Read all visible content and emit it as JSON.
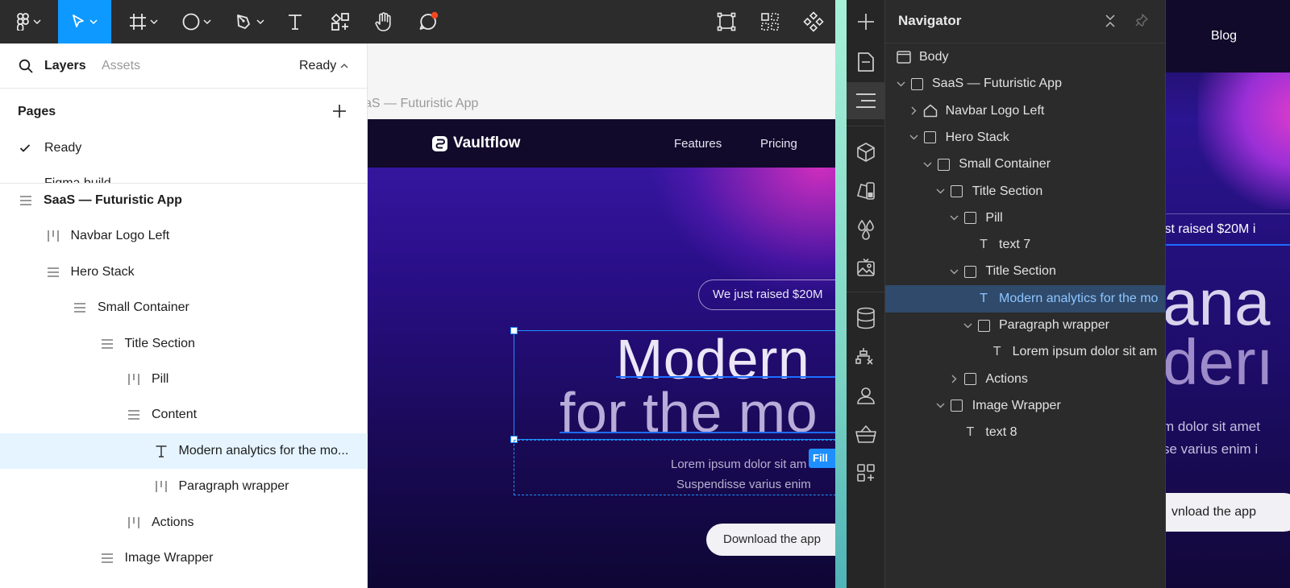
{
  "figma": {
    "left_panel": {
      "tabs": {
        "layers": "Layers",
        "assets": "Assets",
        "page_selector": "Ready"
      },
      "pages": {
        "title": "Pages",
        "items": [
          {
            "label": "Ready",
            "checked": true
          },
          {
            "label": "Figma build",
            "checked": false
          }
        ]
      },
      "layers": [
        {
          "label": "SaaS — Futuristic App",
          "icon": "stack-icon",
          "depth": 0,
          "bold": true
        },
        {
          "label": "Navbar Logo Left",
          "icon": "columns-icon",
          "depth": 1
        },
        {
          "label": "Hero Stack",
          "icon": "stack-icon",
          "depth": 1
        },
        {
          "label": "Small Container",
          "icon": "stack-icon",
          "depth": 2
        },
        {
          "label": "Title Section",
          "icon": "stack-icon",
          "depth": 3
        },
        {
          "label": "Pill",
          "icon": "columns-icon",
          "depth": 4
        },
        {
          "label": "Content",
          "icon": "stack-icon",
          "depth": 4
        },
        {
          "label": "Modern analytics for the mo...",
          "icon": "text-icon",
          "depth": 5,
          "selected": true
        },
        {
          "label": "Paragraph wrapper",
          "icon": "columns-icon",
          "depth": 5
        },
        {
          "label": "Actions",
          "icon": "columns-icon",
          "depth": 4
        },
        {
          "label": "Image Wrapper",
          "icon": "stack-icon",
          "depth": 3
        }
      ]
    },
    "canvas": {
      "frame_label": "aS — Futuristic  App",
      "site": {
        "logo": "Vaultflow",
        "nav_links": [
          "Features",
          "Pricing"
        ],
        "pill": "We just raised $20M",
        "hero_line_1": "Modern",
        "hero_line_2": "for the mo",
        "para_line_1": "Lorem ipsum dolor sit am",
        "para_line_2": "Suspendisse varius enim",
        "fill_tag": "Fill",
        "cta": "Download the app"
      }
    },
    "colors": {
      "accent": "#0d99ff",
      "selection": "#1e90ff"
    }
  },
  "webflow": {
    "navigator": {
      "title": "Navigator",
      "tree": [
        {
          "label": "Body",
          "icon": "body",
          "depth": 0,
          "caret": "none"
        },
        {
          "label": "SaaS — Futuristic App",
          "icon": "box",
          "depth": 0,
          "caret": "down"
        },
        {
          "label": "Navbar Logo Left",
          "icon": "home",
          "depth": 1,
          "caret": "right"
        },
        {
          "label": "Hero Stack",
          "icon": "box",
          "depth": 1,
          "caret": "down"
        },
        {
          "label": "Small Container",
          "icon": "box",
          "depth": 2,
          "caret": "down"
        },
        {
          "label": "Title Section",
          "icon": "box",
          "depth": 3,
          "caret": "down"
        },
        {
          "label": "Pill",
          "icon": "box",
          "depth": 4,
          "caret": "down"
        },
        {
          "label": "text 7",
          "icon": "text",
          "depth": 5,
          "caret": "none"
        },
        {
          "label": "Title Section",
          "icon": "box",
          "depth": 4,
          "caret": "down"
        },
        {
          "label": "Modern analytics for the mo",
          "icon": "text",
          "depth": 5,
          "caret": "none",
          "selected": true
        },
        {
          "label": "Paragraph wrapper",
          "icon": "box",
          "depth": 5,
          "caret": "down"
        },
        {
          "label": "Lorem ipsum dolor sit am",
          "icon": "text",
          "depth": 6,
          "caret": "none"
        },
        {
          "label": "Actions",
          "icon": "box",
          "depth": 4,
          "caret": "right"
        },
        {
          "label": "Image Wrapper",
          "icon": "box",
          "depth": 3,
          "caret": "down"
        },
        {
          "label": "text 8",
          "icon": "text",
          "depth": 4,
          "caret": "none"
        }
      ]
    },
    "preview": {
      "nav_link": "Blog",
      "pill": "ıst raised $20M i",
      "hero_line_1": "ana",
      "hero_line_2": "derı",
      "para_line_1": "m dolor sit amet",
      "para_line_2": "se varius enim i",
      "cta": "vnload the app"
    }
  }
}
